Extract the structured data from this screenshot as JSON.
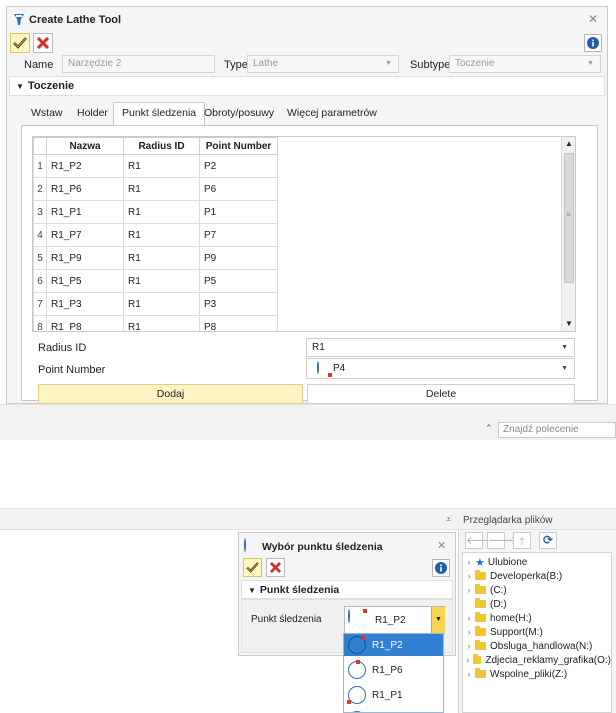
{
  "main_dialog": {
    "title": "Create Lathe Tool",
    "fields": {
      "name_label": "Name",
      "name_value": "Narzędzie 2",
      "type_label": "Type",
      "type_value": "Lathe",
      "subtype_label": "Subtype",
      "subtype_value": "Toczenie"
    },
    "section_title": "Toczenie",
    "tabs": [
      {
        "label": "Wstaw",
        "active": false
      },
      {
        "label": "Holder",
        "active": false
      },
      {
        "label": "Punkt śledzenia",
        "active": true
      },
      {
        "label": "Obroty/posuwy",
        "active": false
      },
      {
        "label": "Więcej parametrów",
        "active": false
      }
    ],
    "table": {
      "columns": [
        "Nazwa",
        "Radius ID",
        "Point Number"
      ],
      "rows": [
        {
          "n": "1",
          "nazwa": "R1_P2",
          "radius": "R1",
          "point": "P2"
        },
        {
          "n": "2",
          "nazwa": "R1_P6",
          "radius": "R1",
          "point": "P6"
        },
        {
          "n": "3",
          "nazwa": "R1_P1",
          "radius": "R1",
          "point": "P1"
        },
        {
          "n": "4",
          "nazwa": "R1_P7",
          "radius": "R1",
          "point": "P7"
        },
        {
          "n": "5",
          "nazwa": "R1_P9",
          "radius": "R1",
          "point": "P9"
        },
        {
          "n": "6",
          "nazwa": "R1_P5",
          "radius": "R1",
          "point": "P5"
        },
        {
          "n": "7",
          "nazwa": "R1_P3",
          "radius": "R1",
          "point": "P3"
        },
        {
          "n": "8",
          "nazwa": "R1_P8",
          "radius": "R1",
          "point": "P8"
        }
      ]
    },
    "radius_id_label": "Radius ID",
    "radius_id_value": "R1",
    "point_number_label": "Point Number",
    "point_number_value": "P4",
    "add_button": "Dodaj",
    "delete_button": "Delete"
  },
  "command_search": {
    "placeholder": "Znajdź polecenie"
  },
  "file_browser": {
    "title": "Przeglądarka plików",
    "items": [
      {
        "label": "Ulubione",
        "kind": "star"
      },
      {
        "label": "Developerka(B:)",
        "kind": "folder"
      },
      {
        "label": "(C:)",
        "kind": "folder"
      },
      {
        "label": "(D:)",
        "kind": "folder"
      },
      {
        "label": "home(H:)",
        "kind": "folder"
      },
      {
        "label": "Support(M:)",
        "kind": "folder"
      },
      {
        "label": "Obsluga_handlowa(N:)",
        "kind": "folder"
      },
      {
        "label": "Zdjecia_reklamy_grafika(O:)",
        "kind": "folder"
      },
      {
        "label": "Wspolne_pliki(Z:)",
        "kind": "folder"
      }
    ]
  },
  "tracking_dialog": {
    "title": "Wybór punktu śledzenia",
    "section_title": "Punkt śledzenia",
    "field_label": "Punkt śledzenia",
    "selected_value": "R1_P2",
    "options": [
      "R1_P2",
      "R1_P6",
      "R1_P1"
    ]
  },
  "colors": {
    "accent_yellow": "#fff3c4",
    "selection_blue": "#2f7fd3",
    "cancel_red": "#d32f2f",
    "folder_yellow": "#f3c534"
  }
}
